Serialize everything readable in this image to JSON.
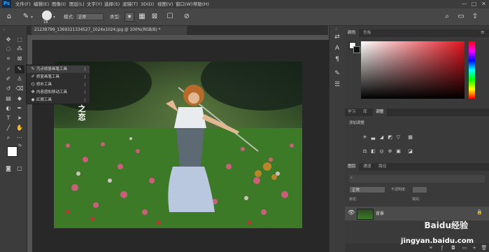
{
  "app": {
    "logo": "Ps"
  },
  "menu": [
    "文件(F)",
    "编辑(E)",
    "图像(I)",
    "图层(L)",
    "文字(Y)",
    "选择(S)",
    "滤镜(T)",
    "3D(D)",
    "视图(V)",
    "窗口(W)",
    "帮助(H)"
  ],
  "window_controls": {
    "minimize": "—",
    "maximize": "□",
    "close": "✕"
  },
  "options": {
    "mode_label": "模式:",
    "mode_value": "正常",
    "type_label": "类型:",
    "brush_size": "19"
  },
  "document_tab": {
    "title": "21238799_1369321334527_1024x1024.jpg @ 100%(RGB/8) *"
  },
  "flyout": {
    "items": [
      {
        "label": "污点修复画笔工具",
        "shortcut": "J"
      },
      {
        "label": "修复画笔工具",
        "shortcut": "J"
      },
      {
        "label": "修补工具",
        "shortcut": "J"
      },
      {
        "label": "内容感知移动工具",
        "shortcut": "J"
      },
      {
        "label": "红眼工具",
        "shortcut": "J"
      }
    ]
  },
  "canvas": {
    "overlay_text": "花之恋"
  },
  "panels": {
    "color_tabs": [
      "颜色",
      "色板"
    ],
    "adjust_tabs": [
      "学习",
      "库",
      "调整"
    ],
    "adjust_title": "添加调整",
    "layer_tabs": [
      "图层",
      "通道",
      "路径"
    ],
    "layer_blend": "正常",
    "layer_opacity_label": "不透明度:",
    "layer_fill_label": "填充:",
    "layer_lock_label": "锁定:",
    "layer_name": "背景"
  },
  "watermark": {
    "text": "Baidu经验",
    "url": "jingyan.baidu.com"
  },
  "colors": {
    "accent": "#31a8ff",
    "panel": "#3a3a3a",
    "canvas_bg": "#282828"
  }
}
